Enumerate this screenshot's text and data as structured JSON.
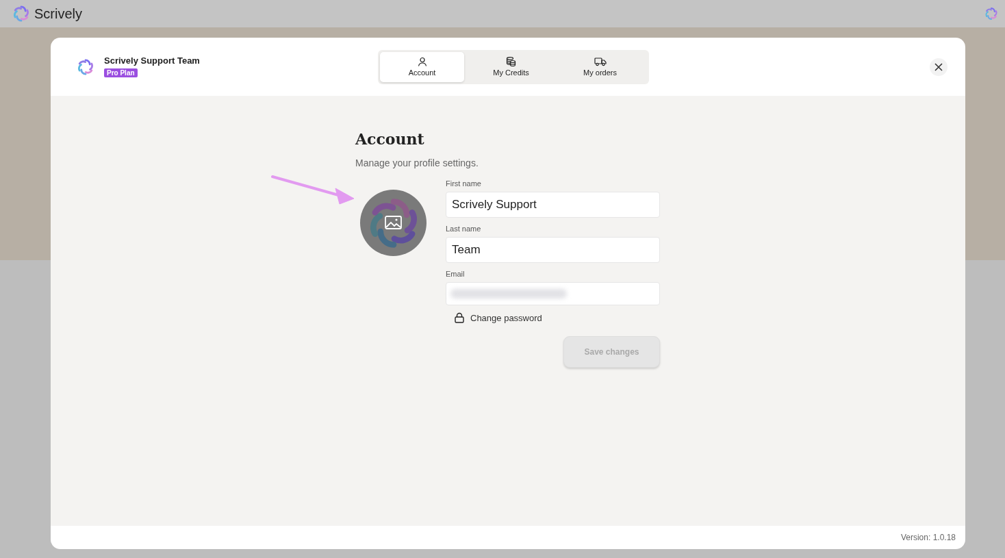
{
  "app_bar": {
    "brand": "Scrively"
  },
  "dialog": {
    "user": {
      "name": "Scrively Support Team",
      "plan": "Pro Plan"
    },
    "tabs": [
      {
        "label": "Account",
        "kind": "person",
        "selected": true
      },
      {
        "label": "My Credits",
        "kind": "coins",
        "selected": false
      },
      {
        "label": "My orders",
        "kind": "truck",
        "selected": false
      }
    ],
    "heading": "Account",
    "subtitle": "Manage your profile settings.",
    "fields": [
      {
        "label": "First name",
        "kind": "text",
        "value": "Scrively Support"
      },
      {
        "label": "Last name",
        "kind": "text",
        "value": "Team"
      },
      {
        "label": "Email",
        "kind": "redacted"
      }
    ],
    "change_password": "Change password",
    "save_button": {
      "label": "Save changes",
      "disabled": true
    },
    "version": "Version: 1.0.18"
  }
}
